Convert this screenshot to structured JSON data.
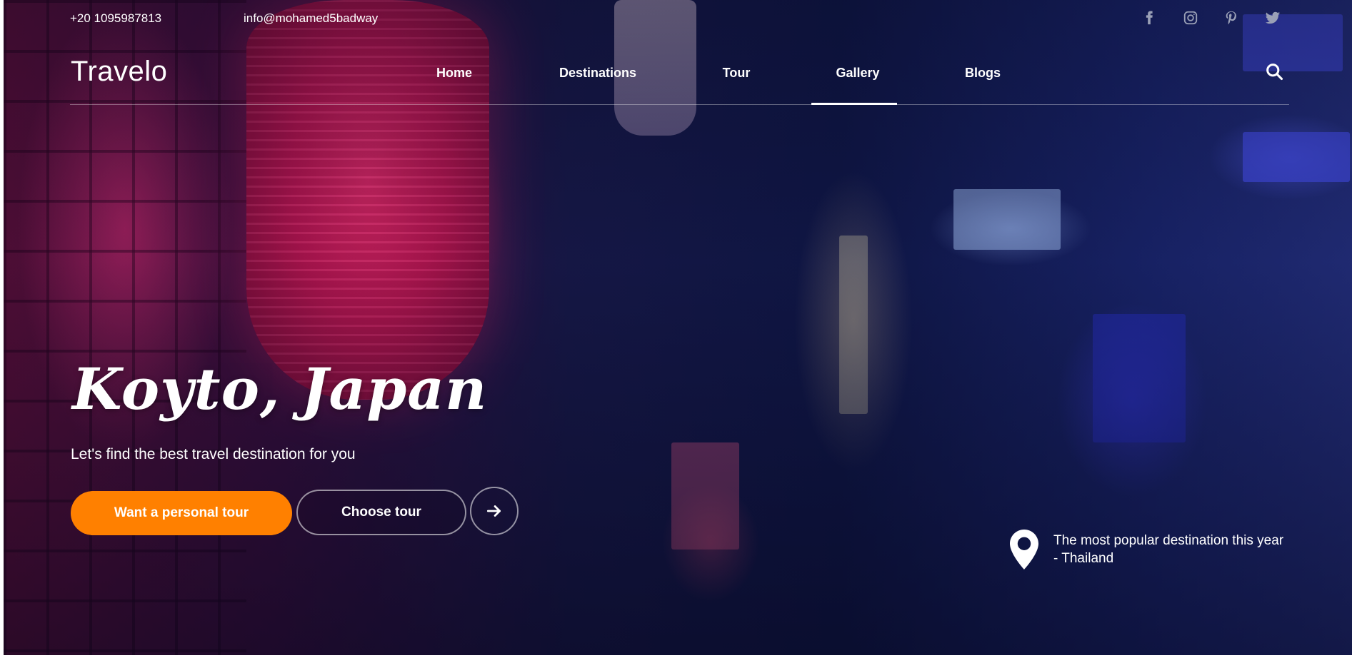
{
  "topbar": {
    "phone": "+20 1095987813",
    "email": "info@mohamed5badway",
    "social": [
      {
        "icon": "facebook-icon"
      },
      {
        "icon": "instagram-icon"
      },
      {
        "icon": "pinterest-icon"
      },
      {
        "icon": "twitter-icon"
      }
    ]
  },
  "header": {
    "logo": "Travelo",
    "nav": [
      {
        "label": "Home"
      },
      {
        "label": "Destinations"
      },
      {
        "label": "Tour"
      },
      {
        "label": "Gallery",
        "active": true
      },
      {
        "label": "Blogs"
      }
    ],
    "search_icon": "search-icon"
  },
  "hero": {
    "title": "Koyto, Japan",
    "subtitle": "Let's find the best travel destination for you",
    "primary_button": "Want a personal tour",
    "secondary_button": "Choose tour",
    "arrow_icon": "arrow-right-icon",
    "popular": {
      "icon": "map-pin-icon",
      "text": "The most popular destination this year - Thailand"
    }
  },
  "colors": {
    "accent": "#ff8000",
    "text": "#ffffff",
    "social_icon": "#9aa0b6"
  }
}
